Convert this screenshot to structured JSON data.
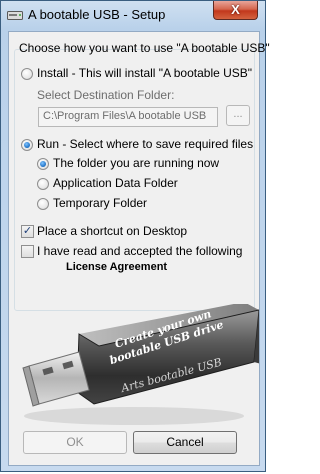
{
  "window": {
    "title": "A bootable USB - Setup",
    "close_label": "X"
  },
  "header": {
    "prompt": "Choose how you want to use \"A bootable USB\""
  },
  "options": {
    "install_label": "Install - This will install \"A bootable USB\"",
    "destination_label": "Select Destination Folder:",
    "destination_value": "C:\\Program Files\\A bootable USB",
    "browse_label": "...",
    "run_label": "Run - Select where to save required files",
    "run_sub": [
      {
        "label": "The folder you are running now",
        "checked": true
      },
      {
        "label": "Application Data Folder",
        "checked": false
      },
      {
        "label": "Temporary Folder",
        "checked": false
      }
    ],
    "shortcut_label": "Place a shortcut on Desktop",
    "shortcut_checked": true,
    "license_text": "I have read and accepted the following",
    "license_link": "License Agreement",
    "license_checked": false
  },
  "graphic": {
    "slogan_line1": "Create your own",
    "slogan_line2": "bootable USB drive",
    "brand": "Arts bootable USB"
  },
  "buttons": {
    "ok": "OK",
    "cancel": "Cancel"
  },
  "colors": {
    "accent": "#1b6fc4",
    "close": "#c2381c",
    "title_bar": "#b9d1ea"
  },
  "icons": {
    "app": "drive-icon",
    "close": "close-icon"
  }
}
